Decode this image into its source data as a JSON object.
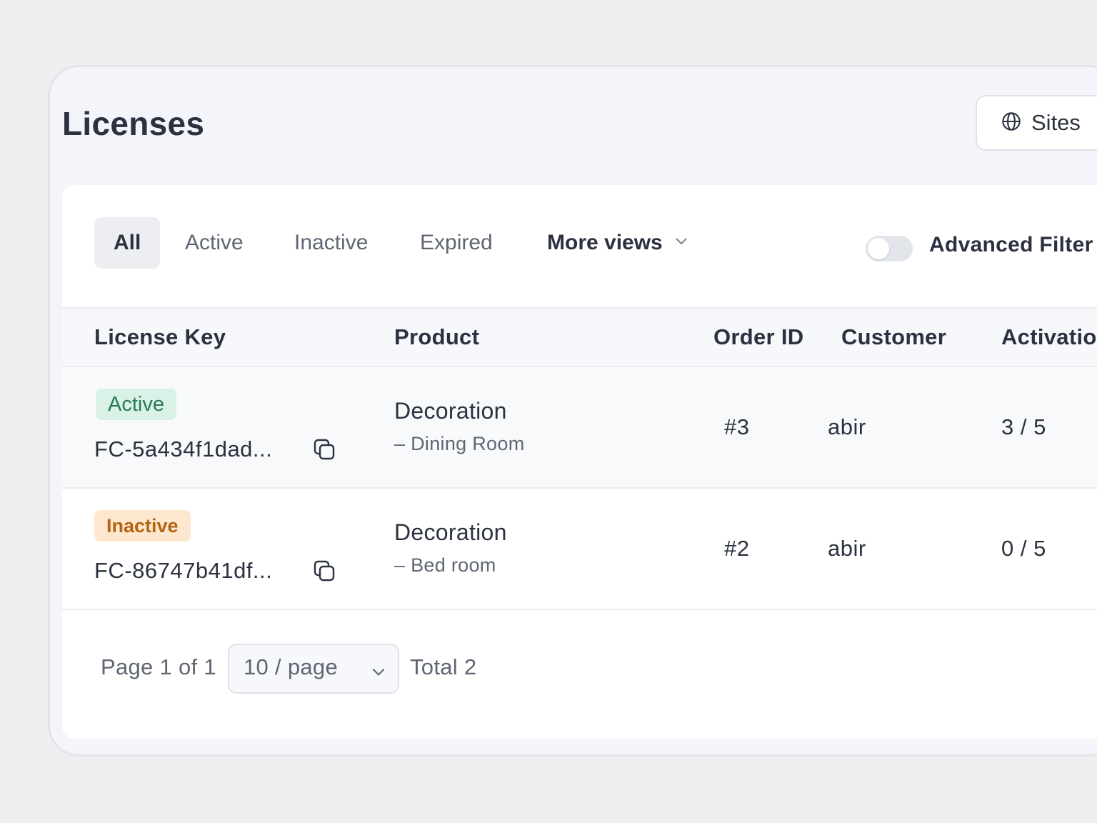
{
  "header": {
    "title": "Licenses",
    "sites_label": "Sites",
    "sites_icon": "globe-icon"
  },
  "filters": {
    "tabs": [
      {
        "label": "All",
        "selected": true
      },
      {
        "label": "Active",
        "selected": false
      },
      {
        "label": "Inactive",
        "selected": false
      },
      {
        "label": "Expired",
        "selected": false
      }
    ],
    "more_views_label": "More views",
    "advanced_filter_label": "Advanced Filter",
    "advanced_filter_enabled": false
  },
  "table": {
    "columns": [
      "License Key",
      "Product",
      "Order ID",
      "Customer",
      "Activatio"
    ],
    "rows": [
      {
        "status": "Active",
        "license_key": "FC-5a434f1dad...",
        "product": "Decoration",
        "variation": "– Dining Room",
        "order_id": "#3",
        "customer": "abir",
        "activations": "3 / 5"
      },
      {
        "status": "Inactive",
        "license_key": "FC-86747b41df...",
        "product": "Decoration",
        "variation": "– Bed room",
        "order_id": "#2",
        "customer": "abir",
        "activations": "0 / 5"
      }
    ]
  },
  "pagination": {
    "page_text": "Page 1 of 1",
    "per_page": "10 / page",
    "total_text": "Total 2"
  },
  "colors": {
    "active_badge_bg": "#d9f1e6",
    "active_badge_text": "#2a7a54",
    "inactive_badge_bg": "#fde8cf",
    "inactive_badge_text": "#b46513"
  }
}
